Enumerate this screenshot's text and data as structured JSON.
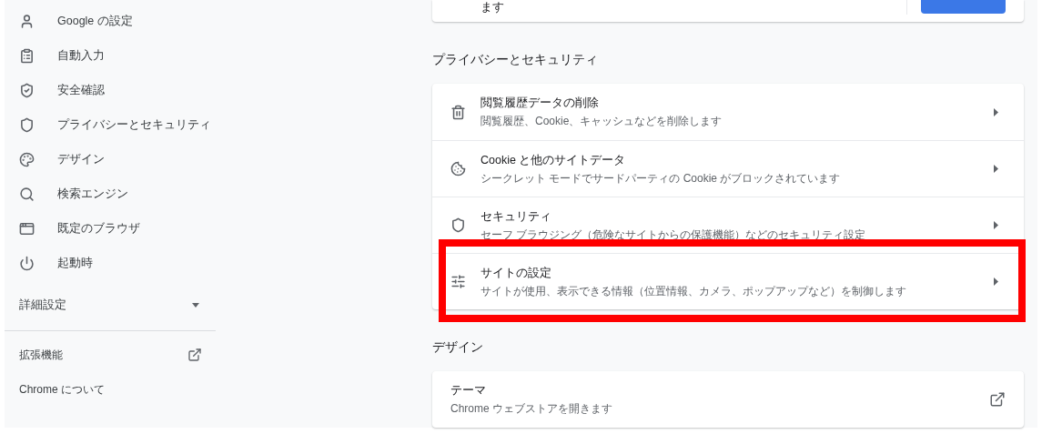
{
  "sidebar": {
    "items": [
      {
        "label": "Google の設定"
      },
      {
        "label": "自動入力"
      },
      {
        "label": "安全確認"
      },
      {
        "label": "プライバシーとセキュリティ"
      },
      {
        "label": "デザイン"
      },
      {
        "label": "検索エンジン"
      },
      {
        "label": "既定のブラウザ"
      },
      {
        "label": "起動時"
      }
    ],
    "advanced": {
      "label": "詳細設定",
      "expanded": false
    },
    "extensions": {
      "label": "拡張機能"
    },
    "about": {
      "label": "Chrome について"
    }
  },
  "top_card": {
    "text": "ます"
  },
  "sections": [
    {
      "title": "プライバシーとセキュリティ",
      "rows": [
        {
          "kind": "subpage",
          "title": "閲覧履歴データの削除",
          "subtitle": "閲覧履歴、Cookie、キャッシュなどを削除します",
          "highlighted": false
        },
        {
          "kind": "subpage",
          "title": "Cookie と他のサイトデータ",
          "subtitle": "シークレット モードでサードパーティの Cookie がブロックされています",
          "highlighted": false
        },
        {
          "kind": "subpage",
          "title": "セキュリティ",
          "subtitle": "セーフ ブラウジング（危険なサイトからの保護機能）などのセキュリティ設定",
          "highlighted": false
        },
        {
          "kind": "subpage",
          "title": "サイトの設定",
          "subtitle": "サイトが使用、表示できる情報（位置情報、カメラ、ポップアップなど）を制御します",
          "highlighted": true
        }
      ]
    },
    {
      "title": "デザイン",
      "rows": [
        {
          "kind": "external",
          "title": "テーマ",
          "subtitle": "Chrome ウェブストアを開きます",
          "highlighted": false
        }
      ]
    }
  ]
}
